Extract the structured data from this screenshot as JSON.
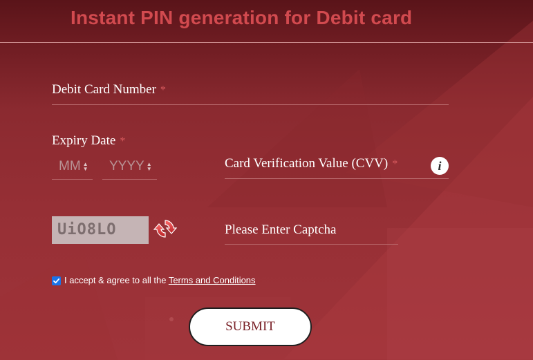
{
  "header": {
    "title": "Instant PIN generation for Debit card"
  },
  "form": {
    "card_number": {
      "label": "Debit Card Number",
      "required_mark": "*"
    },
    "expiry": {
      "label": "Expiry Date",
      "required_mark": "*",
      "month_placeholder": "MM",
      "year_placeholder": "YYYY"
    },
    "cvv": {
      "label": "Card Verification Value (CVV)",
      "required_mark": "*",
      "info_glyph": "i"
    },
    "captcha": {
      "code": "UiO8LO",
      "placeholder": "Please Enter Captcha"
    },
    "agreement": {
      "checked": true,
      "text": "I accept & agree to all the ",
      "link_text": "Terms and Conditions"
    },
    "submit_label": "SUBMIT"
  },
  "colors": {
    "background": "#8e2a2f",
    "title": "#d24a4f",
    "required": "#d85a5e",
    "checkbox": "#1a73e8",
    "refresh_icon": "#d93a3a"
  },
  "icons": {
    "info": "info-icon",
    "refresh": "refresh-icon",
    "select_arrows": "chevron-up-down-icon",
    "checkbox": "checkmark-icon"
  }
}
